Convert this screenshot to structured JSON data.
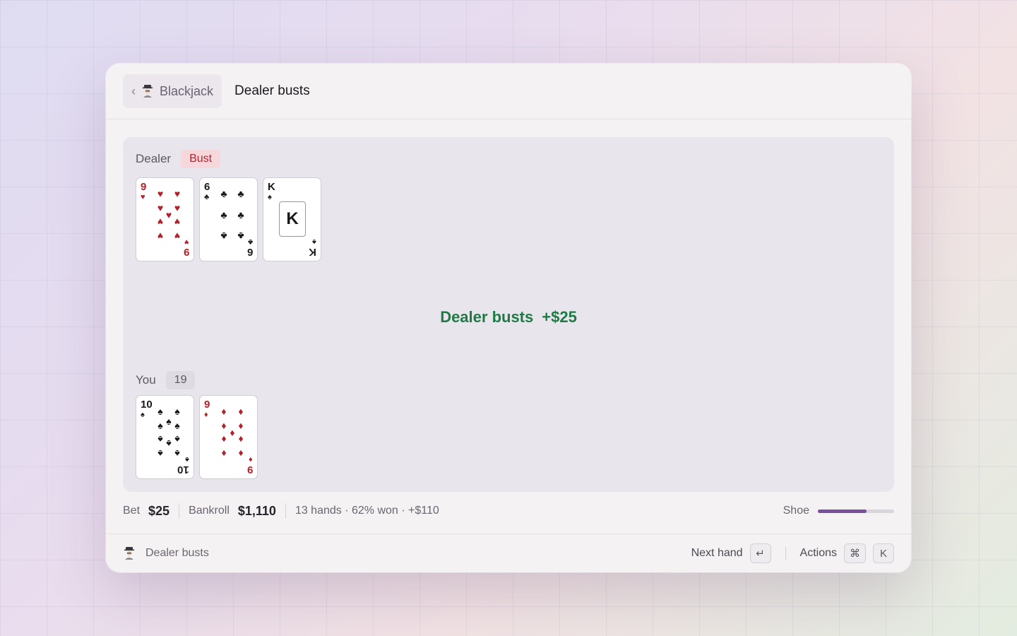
{
  "header": {
    "back_label": "Blackjack",
    "title": "Dealer busts"
  },
  "dealer": {
    "label": "Dealer",
    "badge": "Bust",
    "cards": [
      {
        "rank": "9",
        "suit": "♥",
        "color": "red"
      },
      {
        "rank": "6",
        "suit": "♣",
        "color": "black"
      },
      {
        "rank": "K",
        "suit": "♠",
        "color": "black"
      }
    ]
  },
  "result": {
    "text": "Dealer busts",
    "amount": "+$25"
  },
  "player": {
    "label": "You",
    "total": "19",
    "cards": [
      {
        "rank": "10",
        "suit": "♠",
        "color": "black"
      },
      {
        "rank": "9",
        "suit": "♦",
        "color": "red"
      }
    ]
  },
  "stats": {
    "bet_label": "Bet",
    "bet_value": "$25",
    "bankroll_label": "Bankroll",
    "bankroll_value": "$1,110",
    "summary": "13 hands · 62% won · +$110",
    "shoe_label": "Shoe",
    "shoe_fraction": 0.64
  },
  "footer": {
    "status": "Dealer busts",
    "next_label": "Next hand",
    "next_key": "↵",
    "actions_label": "Actions",
    "actions_keys": [
      "⌘",
      "K"
    ]
  },
  "colors": {
    "win": "#1f7a45",
    "bust": "#b2262f",
    "accent": "#7b4fa0"
  }
}
